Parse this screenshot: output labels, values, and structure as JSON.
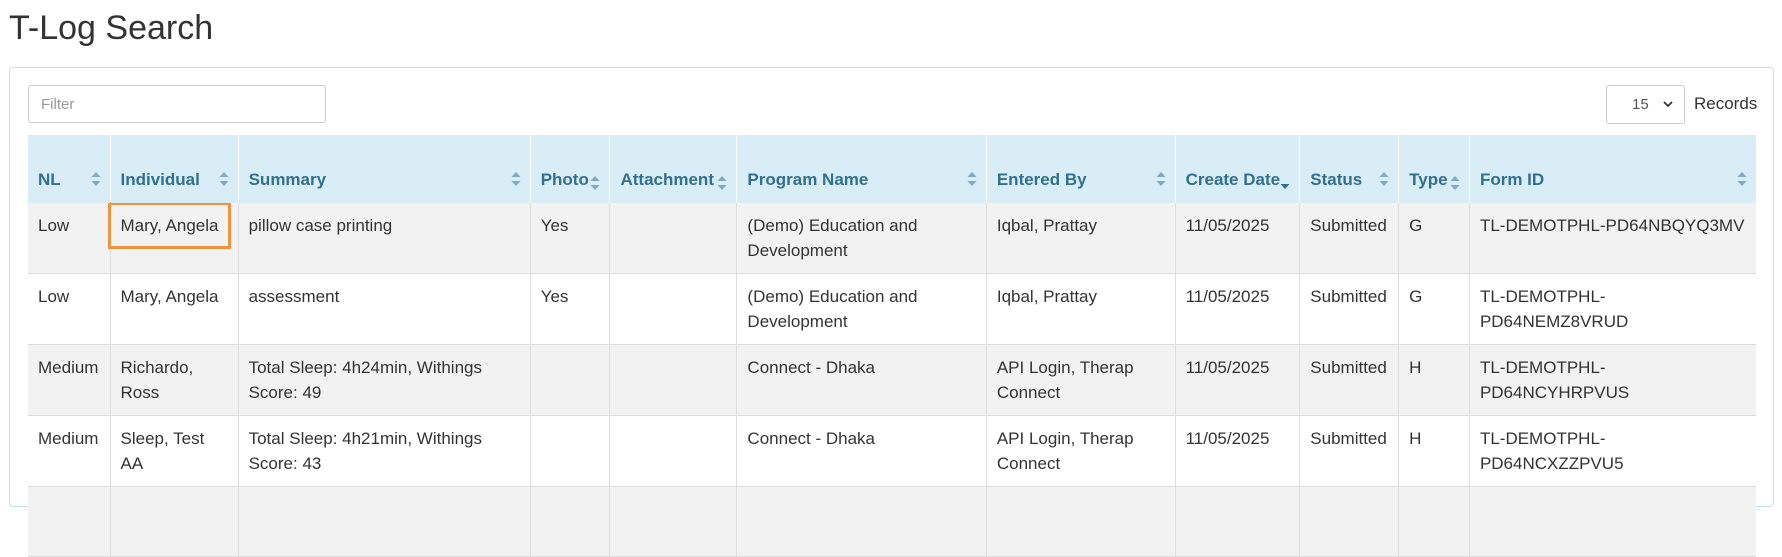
{
  "page": {
    "title": "T-Log Search"
  },
  "toolbar": {
    "filter_placeholder": "Filter",
    "records_value": "15",
    "records_label": "Records"
  },
  "table": {
    "columns": [
      {
        "key": "nl",
        "label": "NL",
        "sort": "both"
      },
      {
        "key": "individual",
        "label": "Individual",
        "sort": "both"
      },
      {
        "key": "summary",
        "label": "Summary",
        "sort": "both"
      },
      {
        "key": "photo",
        "label": "Photo",
        "sort": "both"
      },
      {
        "key": "attachment",
        "label": "Attachment",
        "sort": "both"
      },
      {
        "key": "program",
        "label": "Program Name",
        "sort": "both"
      },
      {
        "key": "entered_by",
        "label": "Entered By",
        "sort": "both"
      },
      {
        "key": "create_date",
        "label": "Create Date",
        "sort": "desc"
      },
      {
        "key": "status",
        "label": "Status",
        "sort": "both"
      },
      {
        "key": "type",
        "label": "Type",
        "sort": "both"
      },
      {
        "key": "form_id",
        "label": "Form ID",
        "sort": "both"
      }
    ],
    "rows": [
      {
        "nl": "Low",
        "individual": "Mary, Angela",
        "summary": "pillow case printing",
        "photo": "Yes",
        "attachment": "",
        "program": "(Demo) Education and Development",
        "entered_by": "Iqbal, Prattay",
        "create_date": "11/05/2025",
        "status": "Submitted",
        "type": "G",
        "form_id": "TL-DEMOTPHL-PD64NBQYQ3MV",
        "highlight": "individual"
      },
      {
        "nl": "Low",
        "individual": "Mary, Angela",
        "summary": "assessment",
        "photo": "Yes",
        "attachment": "",
        "program": "(Demo) Education and Development",
        "entered_by": "Iqbal, Prattay",
        "create_date": "11/05/2025",
        "status": "Submitted",
        "type": "G",
        "form_id": "TL-DEMOTPHL-PD64NEMZ8VRUD"
      },
      {
        "nl": "Medium",
        "individual": "Richardo, Ross",
        "summary": "Total Sleep: 4h24min, Withings Score: 49",
        "photo": "",
        "attachment": "",
        "program": "Connect - Dhaka",
        "entered_by": "API Login, Therap Connect",
        "create_date": "11/05/2025",
        "status": "Submitted",
        "type": "H",
        "form_id": "TL-DEMOTPHL-PD64NCYHRPVUS"
      },
      {
        "nl": "Medium",
        "individual": "Sleep, Test AA",
        "summary": "Total Sleep: 4h21min, Withings Score: 43",
        "photo": "",
        "attachment": "",
        "program": "Connect - Dhaka",
        "entered_by": "API Login, Therap Connect",
        "create_date": "11/05/2025",
        "status": "Submitted",
        "type": "H",
        "form_id": "TL-DEMOTPHL-PD64NCXZZPVU5"
      },
      {
        "nl": "",
        "individual": "",
        "summary": "",
        "photo": "",
        "attachment": "",
        "program": "",
        "entered_by": "",
        "create_date": "",
        "status": "",
        "type": "",
        "form_id": ""
      }
    ]
  },
  "colors": {
    "header_bg": "#d9edf7",
    "header_text": "#31708f",
    "highlight_outline": "#f0923e",
    "panel_border": "#bfe3ec",
    "sort_icon": "#7fa9c4"
  },
  "icons": {
    "sort": "sort-arrows-icon",
    "sort_desc": "sort-desc-icon",
    "select": "chevron-down-icon"
  }
}
